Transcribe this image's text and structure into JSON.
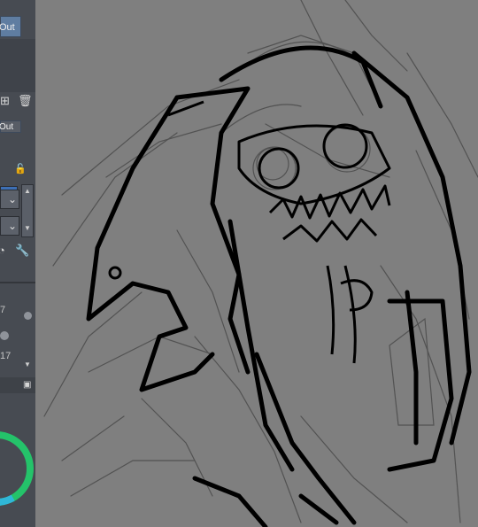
{
  "sidebar": {
    "layer_panel": {
      "out_button_top": "Out",
      "out_button_small": "Out",
      "new_layer_icon": "new-layer-icon",
      "delete_icon": "trash-icon",
      "lock_icon": "lock-icon"
    },
    "brush_panel": {
      "size_value_1": "7",
      "size_value_2": "17"
    },
    "color_wheel": {
      "ring_color": "#24c36a"
    }
  },
  "colors": {
    "panel_bg": "#474b52",
    "canvas_bg": "#7f7f7f",
    "accent_blue": "#3d6fb5",
    "ink": "#000000",
    "sketch": "#444444"
  }
}
